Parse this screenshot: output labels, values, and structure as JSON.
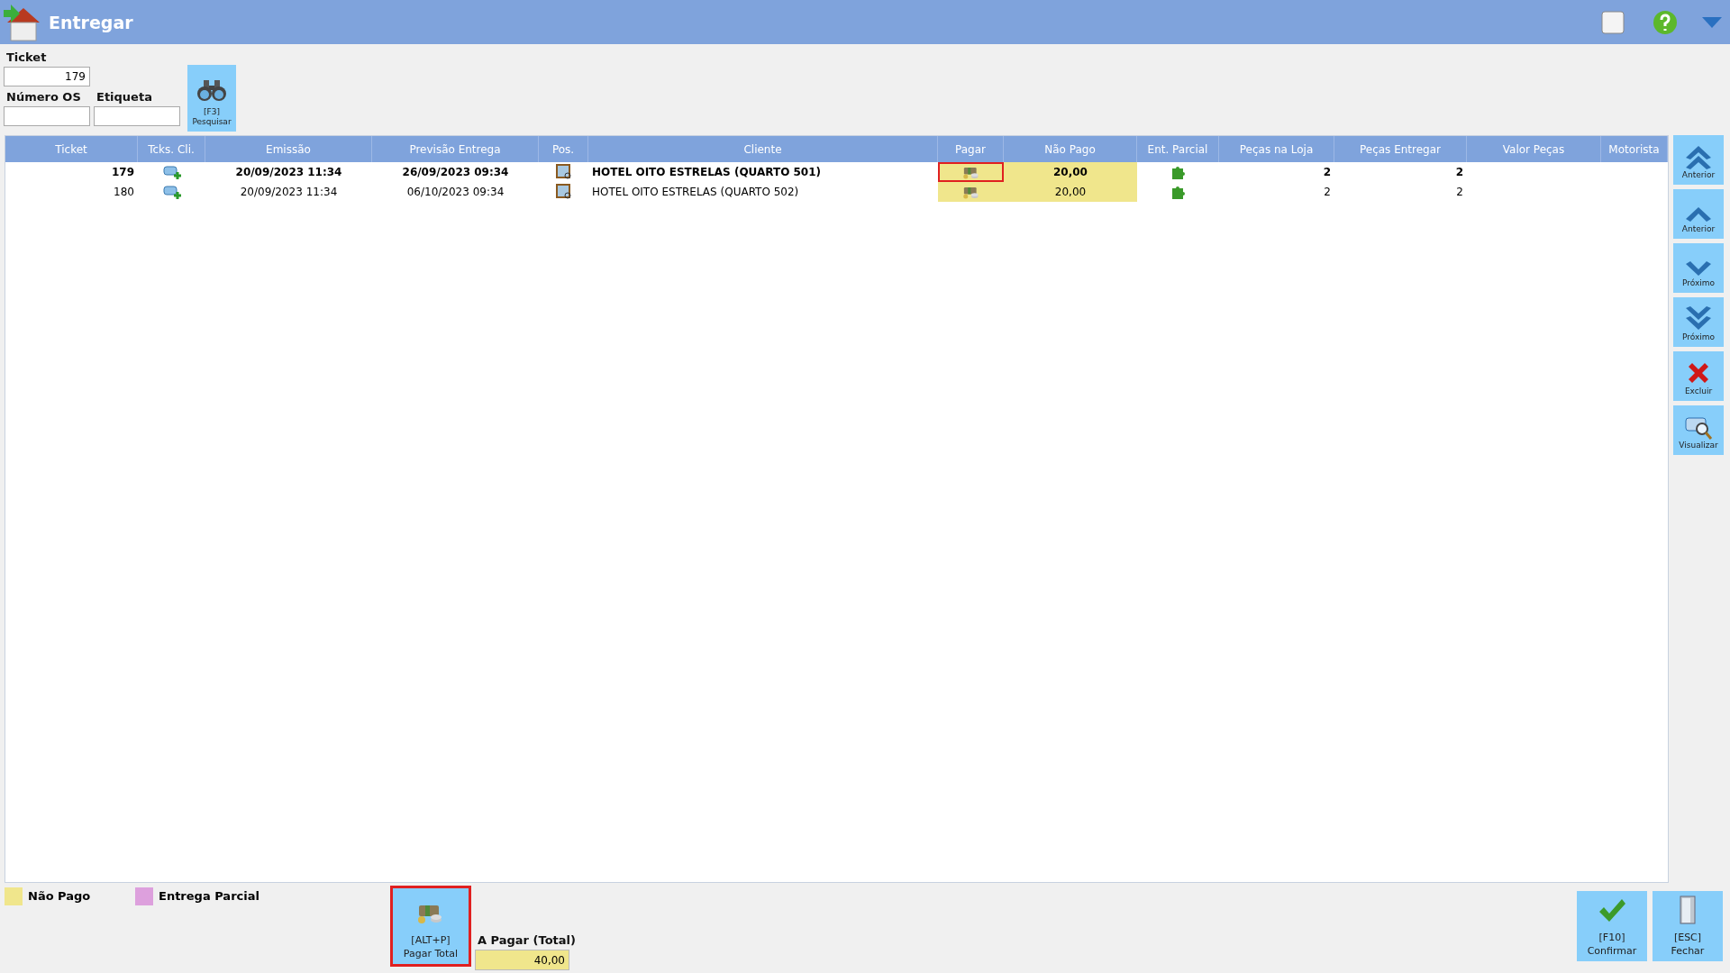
{
  "window": {
    "title": "Entregar"
  },
  "filters": {
    "ticket": {
      "label": "Ticket",
      "value": "179"
    },
    "numero_os": {
      "label": "Número OS"
    },
    "etiqueta": {
      "label": "Etiqueta"
    },
    "search_button": {
      "shortcut": "[F3]",
      "label": "Pesquisar"
    }
  },
  "table": {
    "columns": [
      "Ticket",
      "Tcks. Cli.",
      "Emissão",
      "Previsão Entrega",
      "Pos.",
      "Cliente",
      "Pagar",
      "Não Pago",
      "Ent. Parcial",
      "Peças na Loja",
      "Peças Entregar",
      "Valor Peças",
      "Motorista"
    ],
    "rows": [
      {
        "ticket": "179",
        "emissao": "20/09/2023 11:34",
        "previsao": "26/09/2023 09:34",
        "cliente": "HOTEL OITO ESTRELAS (QUARTO 501)",
        "nao_pago": "20,00",
        "pecas_loja": "2",
        "pecas_entregar": "2",
        "selected": true,
        "unpaid": true,
        "pagar_focused": true
      },
      {
        "ticket": "180",
        "emissao": "20/09/2023 11:34",
        "previsao": "06/10/2023 09:34",
        "cliente": "HOTEL OITO ESTRELAS (QUARTO 502)",
        "nao_pago": "20,00",
        "pecas_loja": "2",
        "pecas_entregar": "2",
        "selected": false,
        "unpaid": true,
        "pagar_focused": false
      }
    ]
  },
  "side_buttons": [
    {
      "kind": "first",
      "label": "Anterior"
    },
    {
      "kind": "prev",
      "label": "Anterior"
    },
    {
      "kind": "next",
      "label": "Próximo"
    },
    {
      "kind": "last",
      "label": "Próximo"
    },
    {
      "kind": "delete",
      "label": "Excluir"
    },
    {
      "kind": "view",
      "label": "Visualizar"
    }
  ],
  "legend": [
    {
      "label": "Não Pago",
      "color": "#f0e68c"
    },
    {
      "label": "Entrega Parcial",
      "color": "#dda0dd"
    }
  ],
  "pay_total": {
    "shortcut": "[ALT+P]",
    "label": "Pagar Total",
    "focused": true
  },
  "total": {
    "label": "A Pagar (Total)",
    "value": "40,00"
  },
  "footer_buttons": [
    {
      "kind": "confirm",
      "shortcut": "[F10]",
      "label": "Confirmar"
    },
    {
      "kind": "close",
      "shortcut": "[ESC]",
      "label": "Fechar"
    }
  ]
}
